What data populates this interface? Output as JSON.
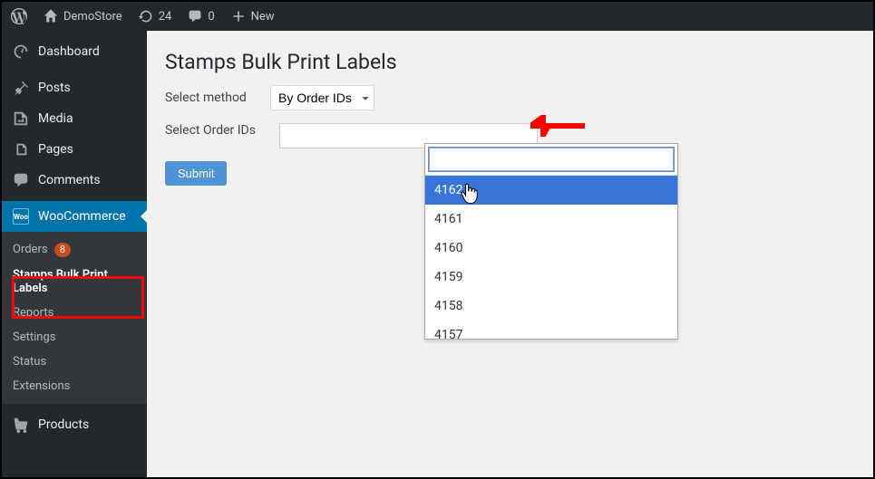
{
  "adminbar": {
    "site_name": "DemoStore",
    "updates_count": "24",
    "comments_count": "0",
    "new_label": "New"
  },
  "sidebar": {
    "dashboard": "Dashboard",
    "posts": "Posts",
    "media": "Media",
    "pages": "Pages",
    "comments": "Comments",
    "woocommerce": "WooCommerce",
    "sub": {
      "orders": "Orders",
      "orders_badge": "8",
      "stamps_bulk": "Stamps Bulk Print Labels",
      "reports": "Reports",
      "settings": "Settings",
      "status": "Status",
      "extensions": "Extensions"
    },
    "products": "Products"
  },
  "page": {
    "title": "Stamps Bulk Print Labels",
    "select_method_label": "Select method",
    "select_method_value": "By Order IDs",
    "select_order_ids_label": "Select Order IDs",
    "submit_label": "Submit",
    "options": [
      "4162",
      "4161",
      "4160",
      "4159",
      "4158",
      "4157"
    ]
  }
}
